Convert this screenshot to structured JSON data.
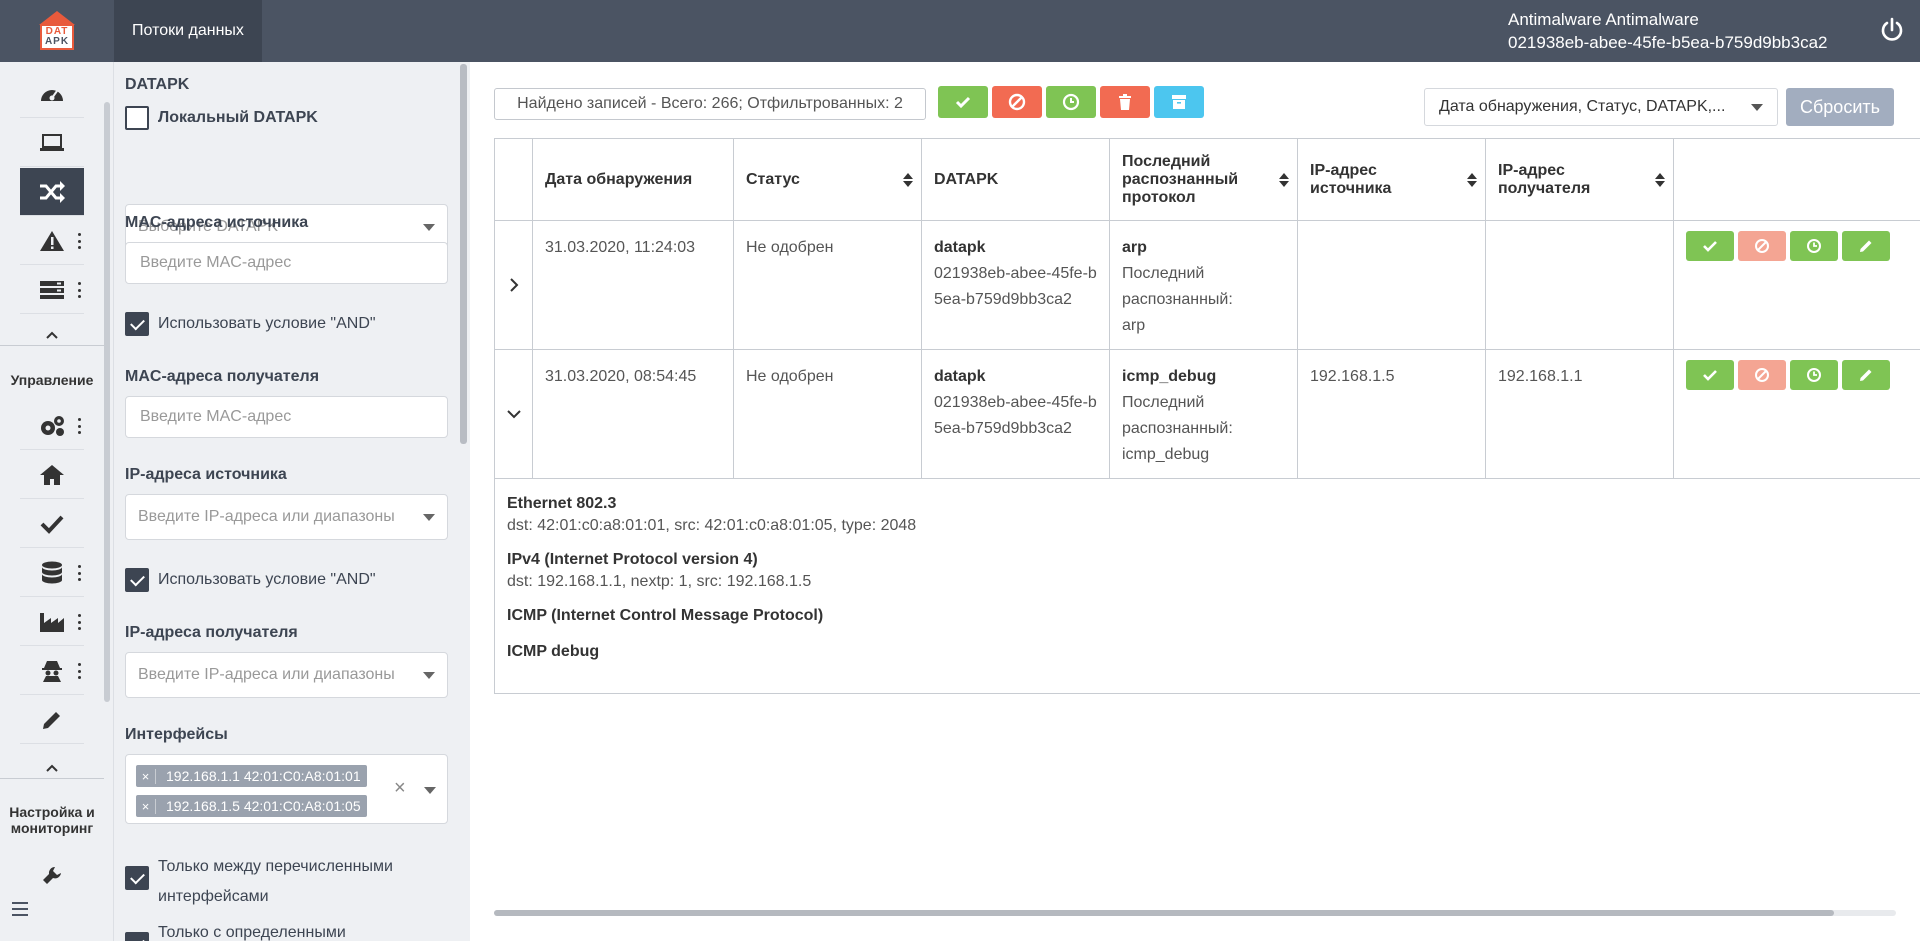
{
  "header": {
    "logo_line1": "DAT",
    "logo_line2": "APK",
    "module_tab": "Потоки данных",
    "user_name": "Antimalware Antimalware",
    "user_id": "021938eb-abee-45fe-b5ea-b759d9bb3ca2"
  },
  "sidebar": {
    "section_manage": "Управление",
    "section_settings": "Настройка и мониторинг"
  },
  "filters": {
    "datapk_label": "DATAPK",
    "local_datapk_label": "Локальный DATAPK",
    "datapk_select_placeholder": "Выберите DATAPK",
    "src_mac_label": "MAC-адреса источника",
    "src_mac_placeholder": "Введите MAC-адрес",
    "and_condition_label": "Использовать условие \"AND\"",
    "dst_mac_label": "MAC-адреса получателя",
    "dst_mac_placeholder": "Введите MAC-адрес",
    "src_ip_label": "IP-адреса источника",
    "src_ip_placeholder": "Введите IP-адреса или диапазоны",
    "and_condition_label_2": "Использовать условие \"AND\"",
    "dst_ip_label": "IP-адреса получателя",
    "dst_ip_placeholder": "Введите IP-адреса или диапазоны",
    "interfaces_label": "Интерфейсы",
    "interfaces": [
      "192.168.1.1 42:01:C0:A8:01:01",
      "192.168.1.5 42:01:C0:A8:01:05"
    ],
    "only_between_label": "Только между перечисленными интерфейсами",
    "only_with_label": "Только с определенными"
  },
  "toolbar": {
    "found_text": "Найдено записей - Всего: 266; Отфильтрованных: 2",
    "sort_select_value": "Дата обнаружения, Статус, DATAPK,...",
    "reset_label": "Сбросить"
  },
  "table": {
    "columns": [
      "Дата обнаружения",
      "Статус",
      "DATAPK",
      "Последний распознанный протокол",
      "IP-адрес источника",
      "IP-адрес получателя"
    ],
    "rows": [
      {
        "date": "31.03.2020, 11:24:03",
        "status": "Не одобрен",
        "datapk_name": "datapk",
        "datapk_id": "021938eb-abee-45fe-b5ea-b759d9bb3ca2",
        "protocol": "arp",
        "protocol_label": "Последний распознанный:",
        "protocol_value": "arp",
        "src_ip": "",
        "dst_ip": ""
      },
      {
        "date": "31.03.2020, 08:54:45",
        "status": "Не одобрен",
        "datapk_name": "datapk",
        "datapk_id": "021938eb-abee-45fe-b5ea-b759d9bb3ca2",
        "protocol": "icmp_debug",
        "protocol_label": "Последний распознанный:",
        "protocol_value": "icmp_debug",
        "src_ip": "192.168.1.5",
        "dst_ip": "192.168.1.1"
      }
    ]
  },
  "details": [
    {
      "title": "Ethernet 802.3",
      "text": "dst: 42:01:c0:a8:01:01, src: 42:01:c0:a8:01:05, type: 2048"
    },
    {
      "title": "IPv4 (Internet Protocol version 4)",
      "text": "dst: 192.168.1.1, nextp: 1, src: 192.168.1.5"
    },
    {
      "title": "ICMP (Internet Control Message Protocol)",
      "text": ""
    },
    {
      "title": "ICMP debug",
      "text": ""
    }
  ],
  "colors": {
    "topbar": "#4b5463",
    "approve": "#7fc454",
    "reject": "#f26b52",
    "delete": "#f26b52",
    "archive": "#4cc6ef",
    "reset": "#a2adbf"
  }
}
